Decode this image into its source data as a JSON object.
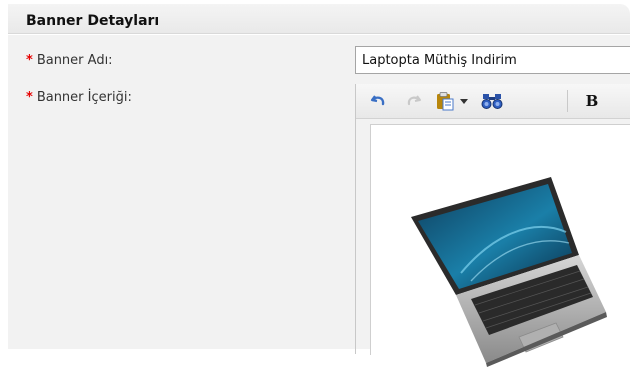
{
  "section": {
    "title": "Banner Detayları"
  },
  "form": {
    "required_marker": "*",
    "name_label": "Banner Adı:",
    "name_value": "Laptopta Müthiş İndirim",
    "content_label": "Banner İçeriği:"
  },
  "editor": {
    "toolbar": {
      "bold_label": "B",
      "icons": [
        "undo-icon",
        "redo-icon",
        "paste-icon",
        "dropdown-arrow-icon",
        "find-icon"
      ]
    },
    "content_image": "laptop-image"
  },
  "colors": {
    "required": "#e60000",
    "panel_bg": "#f2f2f2",
    "header_bg": "#eeeeee"
  }
}
